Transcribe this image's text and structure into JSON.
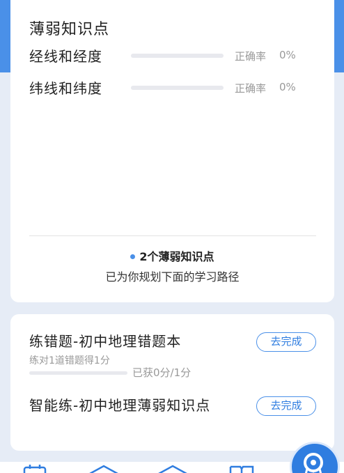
{
  "weak_points": {
    "title": "薄弱知识点",
    "rate_label": "正确率",
    "items": [
      {
        "name": "经线和经度",
        "rate": "0%",
        "progress": 0
      },
      {
        "name": "纬线和纬度",
        "rate": "0%",
        "progress": 0
      }
    ],
    "summary_count": "2个薄弱知识点",
    "summary_sub": "已为你规划下面的学习路径"
  },
  "tasks": [
    {
      "title": "练错题-初中地理错题本",
      "subtitle": "练对1道错题得1分",
      "score": "已获0分/1分",
      "progress": 0,
      "button": "去完成"
    },
    {
      "title": "智能练-初中地理薄弱知识点",
      "button": "去完成"
    }
  ],
  "colors": {
    "accent": "#4a90e8",
    "background": "#e6ecf6"
  },
  "icons": [
    "calendar-icon",
    "home-icon",
    "house-icon",
    "book-icon",
    "award-icon"
  ]
}
